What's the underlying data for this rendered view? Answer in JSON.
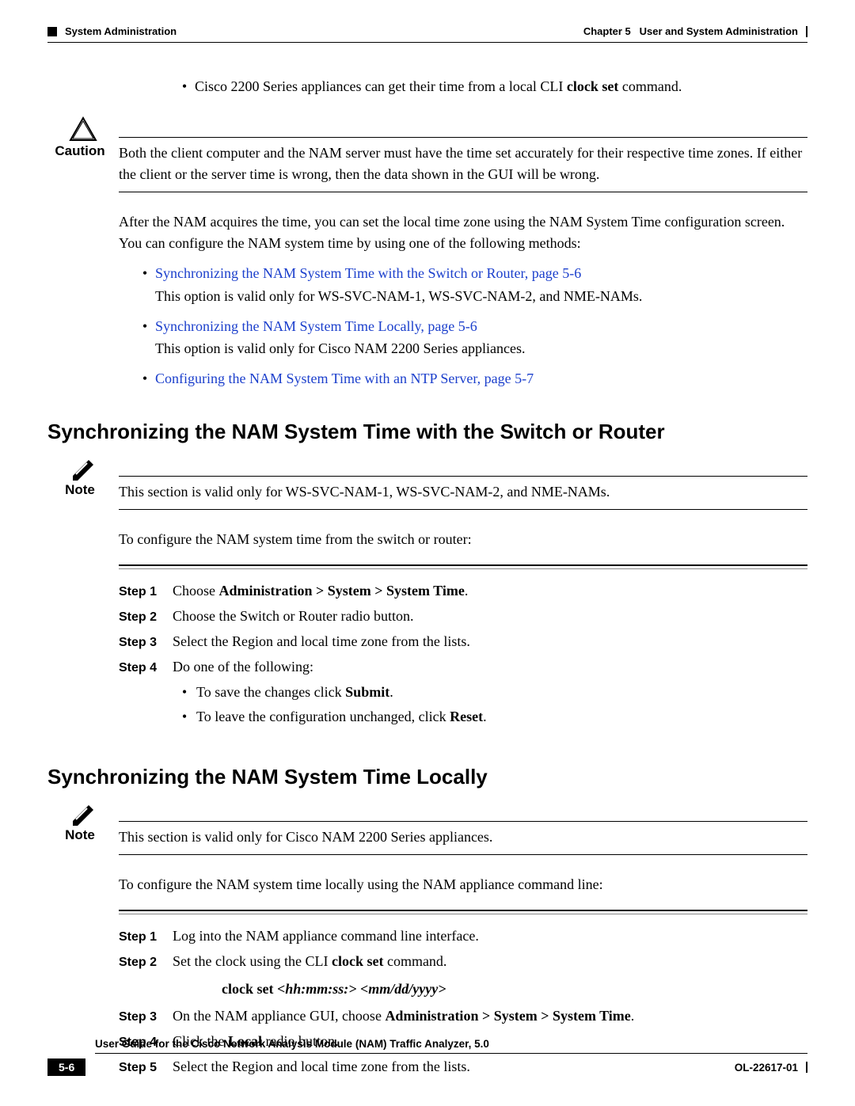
{
  "header": {
    "left": "System Administration",
    "right_chapter": "Chapter 5",
    "right_title": "User and System Administration"
  },
  "intro": {
    "bullet1_pre": "Cisco 2200 Series appliances can get their time from a local CLI ",
    "bullet1_bold": "clock set",
    "bullet1_post": " command."
  },
  "caution": {
    "label": "Caution",
    "text": "Both the client computer and the NAM server must have the time set accurately for their respective time zones. If either the client or the server time is wrong, then the data shown in the GUI will be wrong."
  },
  "para_after_caution": "After the NAM acquires the time, you can set the local time zone using the NAM System Time configuration screen. You can configure the NAM system time by using one of the following methods:",
  "links": {
    "l1": "Synchronizing the NAM System Time with the Switch or Router, page 5-6",
    "l1_sub": "This option is valid only for WS-SVC-NAM-1, WS-SVC-NAM-2, and NME-NAMs.",
    "l2": "Synchronizing the NAM System Time Locally, page 5-6",
    "l2_sub": "This option is valid only for Cisco NAM 2200 Series appliances.",
    "l3": "Configuring the NAM System Time with an NTP Server, page 5-7"
  },
  "section1": {
    "heading": "Synchronizing the NAM System Time with the Switch or Router",
    "note_label": "Note",
    "note_text": "This section is valid only for WS-SVC-NAM-1, WS-SVC-NAM-2, and NME-NAMs.",
    "intro": "To configure the NAM system time from the switch or router:",
    "steps": {
      "s1_label": "Step 1",
      "s1_pre": "Choose ",
      "s1_bold": "Administration > System > System Time",
      "s1_post": ".",
      "s2_label": "Step 2",
      "s2_text": "Choose the Switch or Router radio button.",
      "s3_label": "Step 3",
      "s3_text": "Select the Region and local time zone from the lists.",
      "s4_label": "Step 4",
      "s4_text": "Do one of the following:",
      "s4_b1_pre": "To save the changes click ",
      "s4_b1_bold": "Submit",
      "s4_b1_post": ".",
      "s4_b2_pre": "To leave the configuration unchanged, click ",
      "s4_b2_bold": "Reset",
      "s4_b2_post": "."
    }
  },
  "section2": {
    "heading": "Synchronizing the NAM System Time Locally",
    "note_label": "Note",
    "note_text": "This section is valid only for Cisco NAM 2200 Series appliances.",
    "intro": "To configure the NAM system time locally using the NAM appliance command line:",
    "steps": {
      "s1_label": "Step 1",
      "s1_text": "Log into the NAM appliance command line interface.",
      "s2_label": "Step 2",
      "s2_pre": "Set the clock using the CLI ",
      "s2_bold": "clock set",
      "s2_post": " command.",
      "cmd_bold": "clock set ",
      "cmd_it": "<hh:mm:ss:> <mm/dd/yyyy>",
      "s3_label": "Step 3",
      "s3_pre": "On the NAM appliance GUI, choose ",
      "s3_bold": "Administration > System > System Time",
      "s3_post": ".",
      "s4_label": "Step 4",
      "s4_pre": "Click the ",
      "s4_bold": "Local",
      "s4_post": " radio button.",
      "s5_label": "Step 5",
      "s5_text": "Select the Region and local time zone from the lists."
    }
  },
  "footer": {
    "title": "User Guide for the Cisco Network Analysis Module (NAM) Traffic Analyzer, 5.0",
    "page": "5-6",
    "docnum": "OL-22617-01"
  }
}
